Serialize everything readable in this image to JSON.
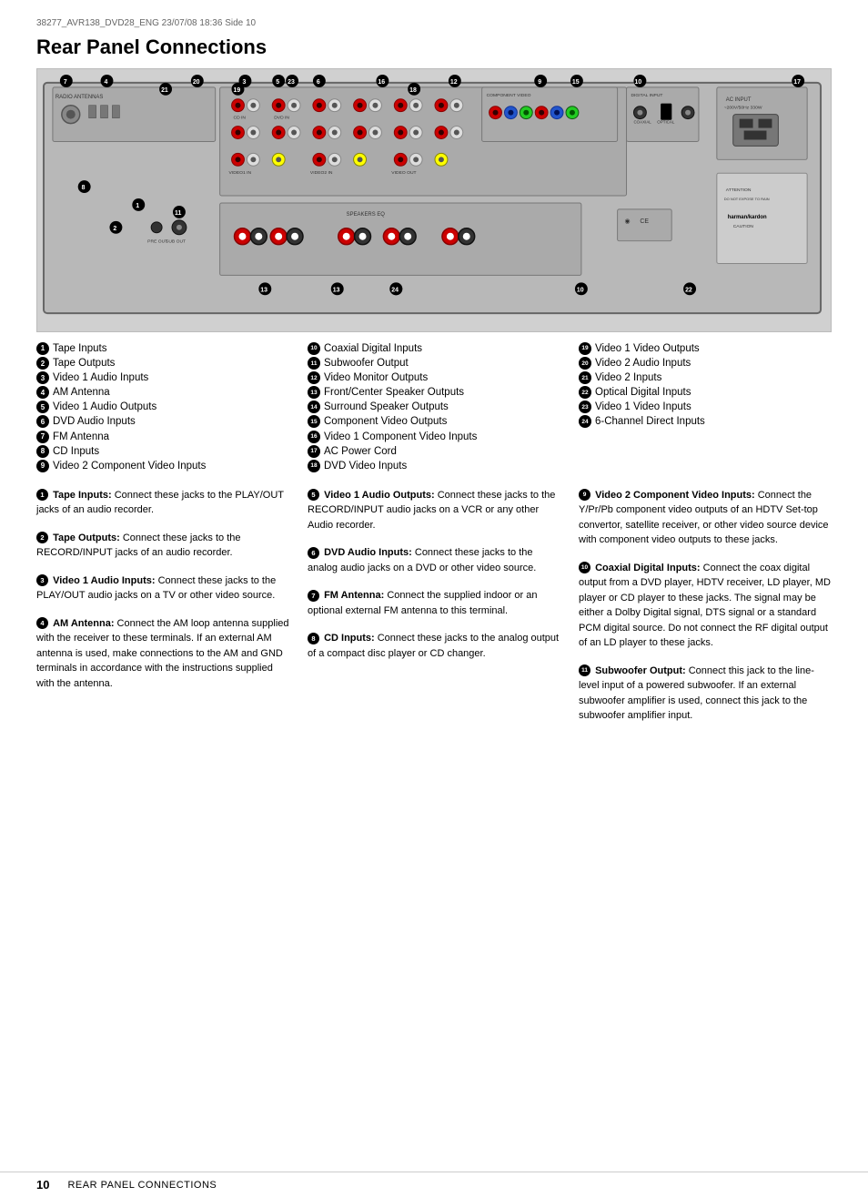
{
  "header": {
    "meta": "38277_AVR138_DVD28_ENG  23/07/08  18:36  Side 10",
    "title": "Rear Panel Connections"
  },
  "footer": {
    "page_num": "10",
    "label": "REAR PANEL CONNECTIONS"
  },
  "legend": [
    {
      "num": "1",
      "label": "Tape Inputs"
    },
    {
      "num": "2",
      "label": "Tape Outputs"
    },
    {
      "num": "3",
      "label": "Video 1 Audio Inputs"
    },
    {
      "num": "4",
      "label": "AM Antenna"
    },
    {
      "num": "5",
      "label": "Video 1 Audio Outputs"
    },
    {
      "num": "6",
      "label": "DVD Audio Inputs"
    },
    {
      "num": "7",
      "label": "FM Antenna"
    },
    {
      "num": "8",
      "label": "CD Inputs"
    },
    {
      "num": "9",
      "label": "Video 2 Component Video Inputs"
    },
    {
      "num": "10",
      "label": "Coaxial Digital Inputs"
    },
    {
      "num": "11",
      "label": "Subwoofer Output"
    },
    {
      "num": "12",
      "label": "Video Monitor Outputs"
    },
    {
      "num": "13",
      "label": "Front/Center Speaker Outputs"
    },
    {
      "num": "14",
      "label": "Surround Speaker Outputs"
    },
    {
      "num": "15",
      "label": "Component Video Outputs"
    },
    {
      "num": "16",
      "label": "Video 1 Component Video Inputs"
    },
    {
      "num": "17",
      "label": "AC Power Cord"
    },
    {
      "num": "18",
      "label": "DVD Video Inputs"
    },
    {
      "num": "19",
      "label": "Video 1 Video Outputs"
    },
    {
      "num": "20",
      "label": "Video 2 Audio Inputs"
    },
    {
      "num": "21",
      "label": "Video 2 Inputs"
    },
    {
      "num": "22",
      "label": "Optical Digital Inputs"
    },
    {
      "num": "23",
      "label": "Video 1 Video Inputs"
    },
    {
      "num": "24",
      "label": "6-Channel Direct Inputs"
    }
  ],
  "descriptions": [
    {
      "num": "1",
      "bold_label": "Tape Inputs:",
      "text": "Connect these jacks to the PLAY/OUT jacks of an audio recorder."
    },
    {
      "num": "2",
      "bold_label": "Tape Outputs:",
      "text": "Connect these jacks to the RECORD/INPUT jacks of an audio recorder."
    },
    {
      "num": "3",
      "bold_label": "Video 1 Audio Inputs:",
      "text": "Connect these jacks to the PLAY/OUT audio jacks on a TV or other video source."
    },
    {
      "num": "4",
      "bold_label": "AM Antenna:",
      "text": "Connect the AM loop antenna supplied with the receiver to these terminals. If an external AM antenna is used, make connections to the AM and GND terminals in accordance with the instructions supplied with the antenna."
    },
    {
      "num": "5",
      "bold_label": "Video 1 Audio Outputs:",
      "text": "Connect these jacks to the RECORD/INPUT audio jacks on a VCR or any other Audio recorder."
    },
    {
      "num": "6",
      "bold_label": "DVD Audio Inputs:",
      "text": "Connect these jacks to the analog audio jacks on a DVD or other video source."
    },
    {
      "num": "7",
      "bold_label": "FM Antenna:",
      "text": "Connect the supplied indoor or an optional external FM antenna to this terminal."
    },
    {
      "num": "8",
      "bold_label": "CD Inputs:",
      "text": "Connect these jacks to the analog output of a compact disc player or CD changer."
    },
    {
      "num": "9",
      "bold_label": "Video 2 Component Video Inputs:",
      "text": "Connect the Y/Pr/Pb component video outputs of an HDTV Set-top convertor, satellite receiver, or other video source device with component video outputs to these jacks."
    },
    {
      "num": "10",
      "bold_label": "Coaxial Digital Inputs:",
      "text": "Connect the coax digital output from a DVD player, HDTV receiver, LD player, MD player or CD player to these jacks. The signal may be either a Dolby Digital signal, DTS signal or a standard PCM digital source. Do not connect the RF digital output of an LD player to these jacks."
    },
    {
      "num": "11",
      "bold_label": "Subwoofer Output:",
      "text": "Connect this jack to the line-level input of a powered subwoofer. If an external subwoofer amplifier is used, connect this jack to the subwoofer amplifier input."
    }
  ]
}
